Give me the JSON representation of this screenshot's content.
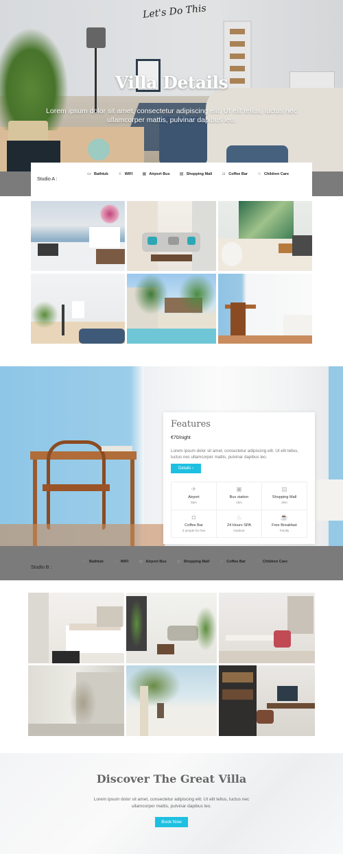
{
  "hero": {
    "title": "Villa Details",
    "subtitle": "Lorem ipsum dolor sit amet, consectetur adipiscing elit. Ut elit tellus, luctus nec ullamcorper mattis, pulvinar dapibus leo.",
    "wall_art": "Let's Do This"
  },
  "studio_a": {
    "label": "Studio A :",
    "amenities": [
      {
        "label": "Bathtub",
        "icon": "bathtub-icon"
      },
      {
        "label": "WIFI",
        "icon": "wifi-icon"
      },
      {
        "label": "Airport Bus",
        "icon": "bus-icon"
      },
      {
        "label": "Shopping Mall",
        "icon": "shopping-icon"
      },
      {
        "label": "Coffee Bar",
        "icon": "coffee-icon"
      },
      {
        "label": "Children Care",
        "icon": "child-icon"
      }
    ]
  },
  "features": {
    "title": "Features",
    "price": "€70/night",
    "description": "Lorem ipsum dolor sit amet, consectetur adipiscing elit. Ut elit tellus, luctus nec ullamcorper mattis, pulvinar dapibus leo.",
    "button": "Details",
    "button_arrow": "›",
    "items": [
      {
        "title": "Airport",
        "sub": "5km",
        "icon": "plane-icon"
      },
      {
        "title": "Bus station",
        "sub": "1km",
        "icon": "bus-icon"
      },
      {
        "title": "Shopping Mall",
        "sub": "2km",
        "icon": "shopping-icon"
      },
      {
        "title": "Coffee Bar",
        "sub": "3 people for free",
        "icon": "coffee-icon"
      },
      {
        "title": "24 Hours SPA",
        "sub": "Outdoor",
        "icon": "spa-icon"
      },
      {
        "title": "Free Breakfast",
        "sub": "Family",
        "icon": "breakfast-icon"
      }
    ]
  },
  "studio_b": {
    "label": "Studio B :",
    "amenities": [
      {
        "label": "Bathtub",
        "icon": "bathtub-icon"
      },
      {
        "label": "WIFI",
        "icon": "wifi-icon"
      },
      {
        "label": "Airport Bus",
        "icon": "bus-icon"
      },
      {
        "label": "Shopping Mall",
        "icon": "shopping-icon"
      },
      {
        "label": "Coffee Bar",
        "icon": "coffee-icon"
      },
      {
        "label": "Children Care",
        "icon": "child-icon"
      }
    ]
  },
  "discover": {
    "title": "Discover The Great Villa",
    "text": "Lorem ipsum dolor sit amet, consectetur adipiscing elit. Ut elit tellus, luctus nec ullamcorper mattis, pulvinar dapibus leo.",
    "button": "Book Now"
  },
  "colors": {
    "accent": "#1ec0e1",
    "band": "#7b7b7b"
  }
}
